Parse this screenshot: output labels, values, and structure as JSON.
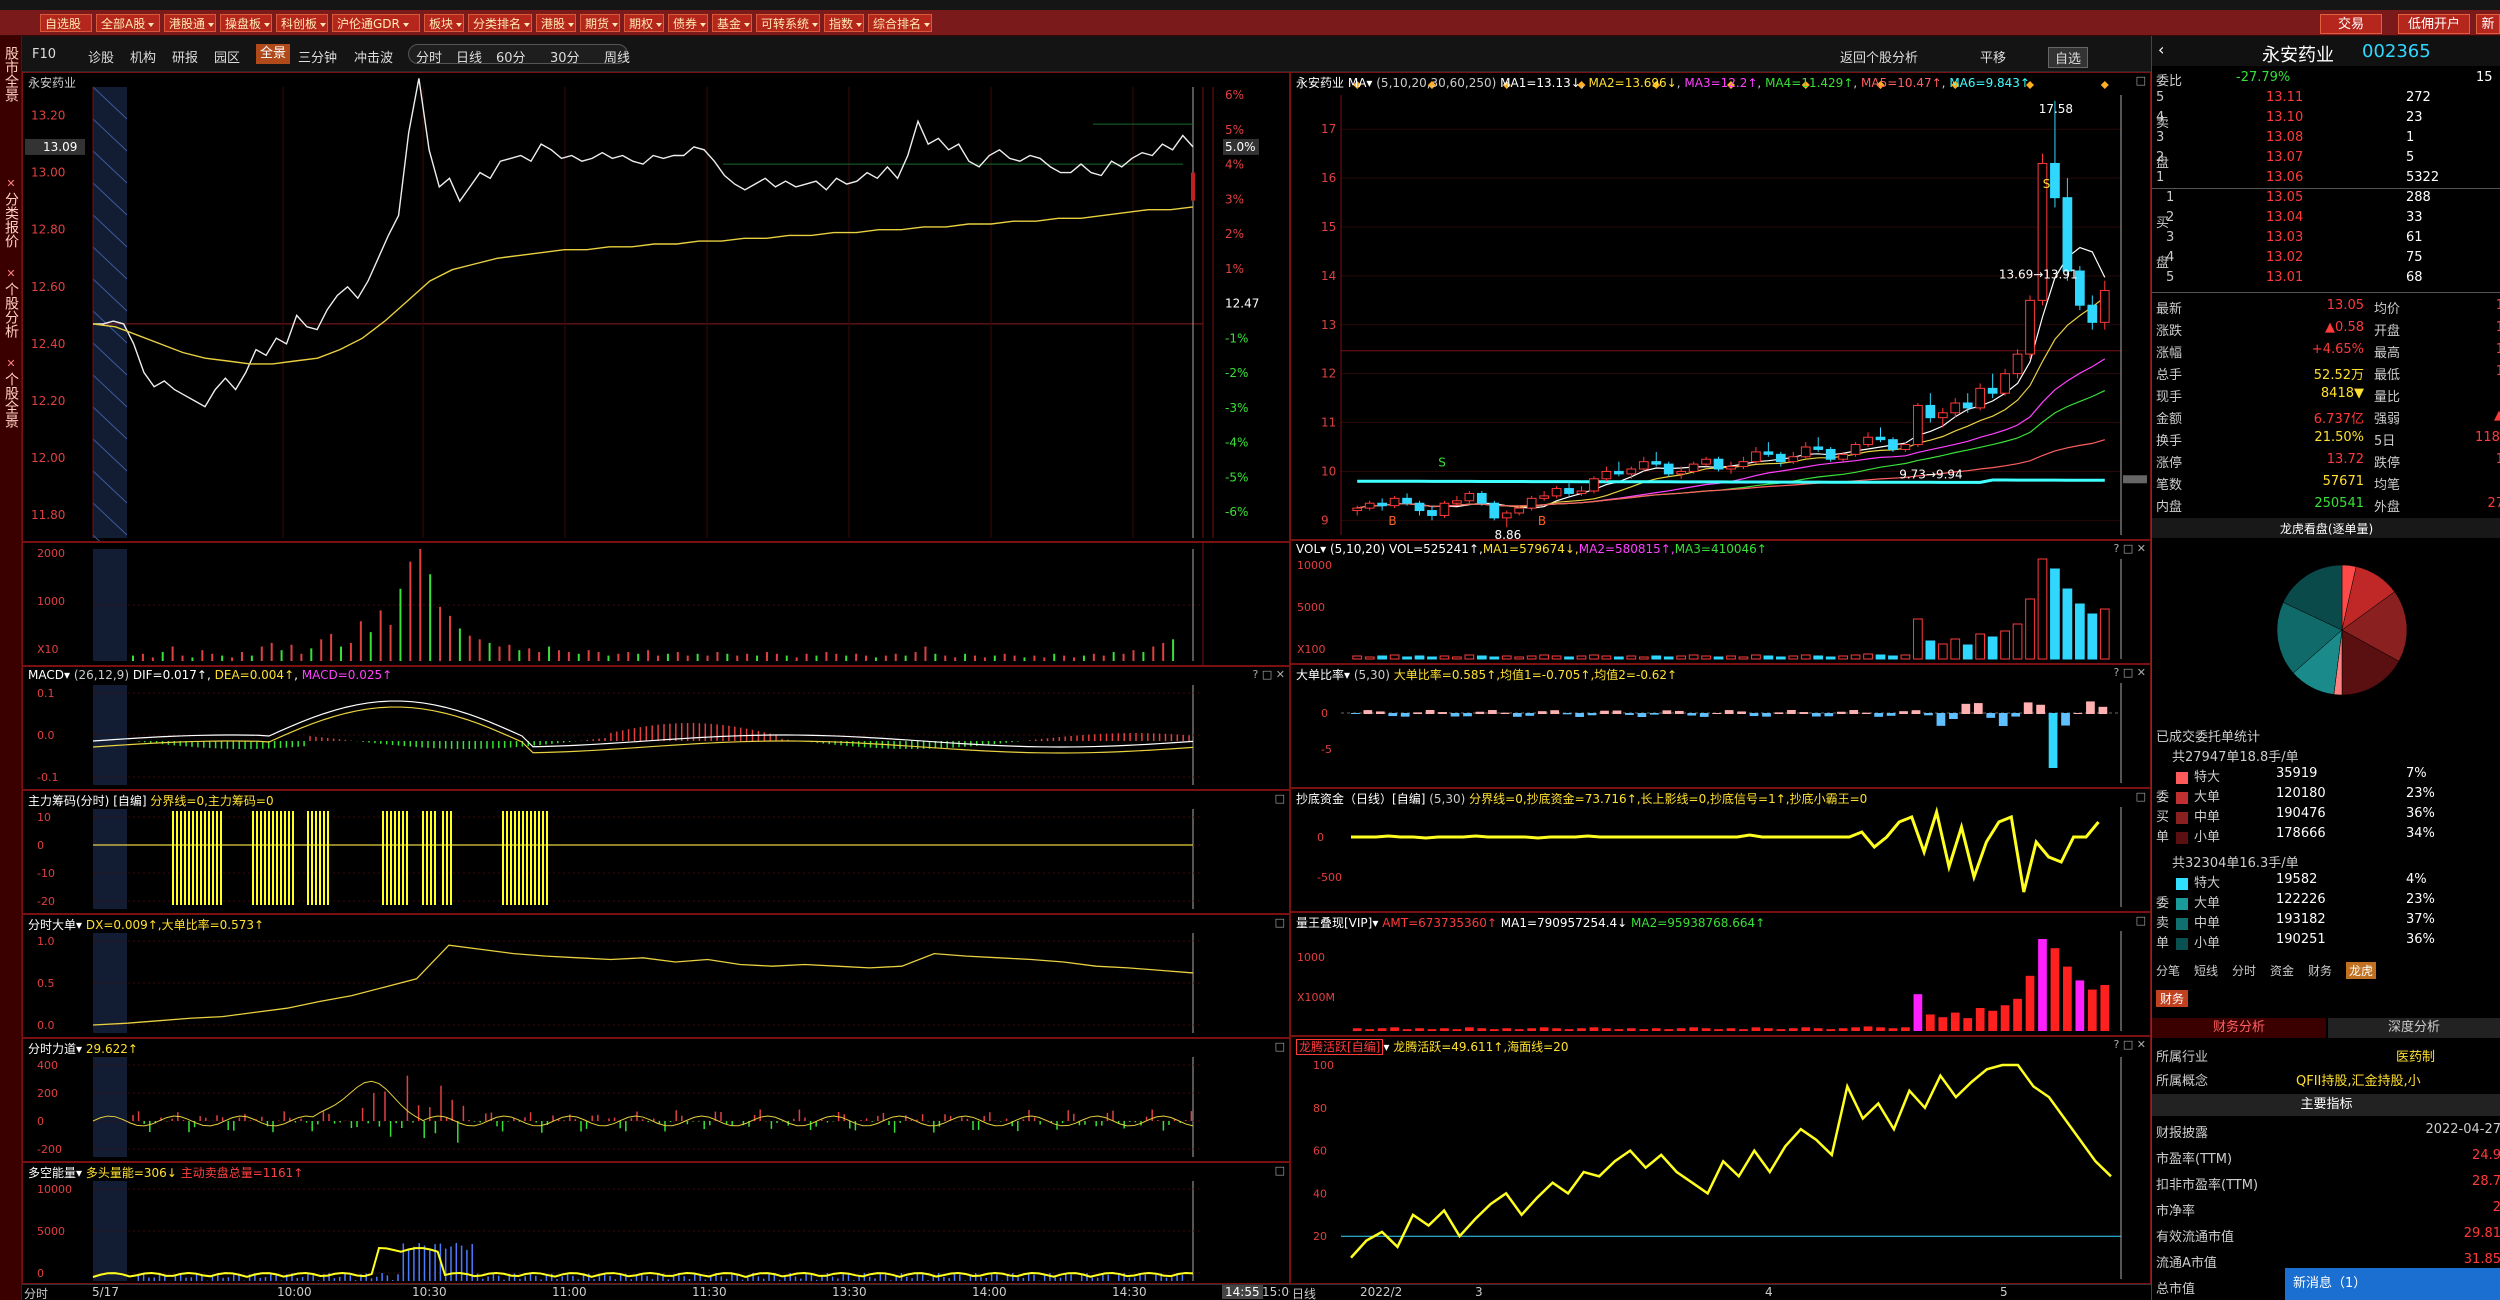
{
  "toolbar": {
    "buttons": [
      "自选股",
      "全部A股",
      "港股通",
      "操盘板",
      "科创板",
      "沪伦通GDR",
      "板块",
      "分类排名",
      "港股",
      "期货",
      "期权",
      "债券",
      "基金",
      "可转系统",
      "指数",
      "综合排名"
    ],
    "trade_btn": "交易",
    "open_account_btn": "低佣开户",
    "news_btn": "新股"
  },
  "leftnav": {
    "items": [
      "股市全景",
      "分类报价",
      "个股分析",
      "个股全景"
    ]
  },
  "periodbar": {
    "items": [
      "F10",
      "诊股",
      "机构",
      "研报",
      "园区",
      "全景",
      "三分钟",
      "冲击波"
    ],
    "selected": "全景",
    "periods": [
      "分时",
      "日线",
      "60分",
      "30分",
      "周线"
    ],
    "right_items": [
      "返回个股分析",
      "平移",
      "自选"
    ]
  },
  "intraday": {
    "stock_name": "永安药业",
    "current_price_label": "13.09",
    "price_ticks": [
      "13.20",
      "13.00",
      "12.80",
      "12.60",
      "12.40",
      "12.20",
      "12.00",
      "11.80"
    ],
    "pct_ticks": [
      "6%",
      "5%",
      "4%",
      "3%",
      "2%",
      "1%",
      "12.47",
      "-1%",
      "-2%",
      "-3%",
      "-4%",
      "-5%",
      "-6%"
    ],
    "current_pct_label": "5.0%",
    "vol_ticks": [
      "2000",
      "1000",
      "X10"
    ],
    "time_ticks": [
      "5/17",
      "10:00",
      "10:30",
      "11:00",
      "11:30",
      "13:30",
      "14:00",
      "14:30",
      "14:55",
      "15:00"
    ],
    "bottom_left": "分时",
    "price_series": [
      12.47,
      12.47,
      12.48,
      12.47,
      12.4,
      12.3,
      12.25,
      12.27,
      12.24,
      12.22,
      12.2,
      12.18,
      12.24,
      12.28,
      12.24,
      12.3,
      12.38,
      12.36,
      12.42,
      12.4,
      12.5,
      12.46,
      12.45,
      12.52,
      12.57,
      12.6,
      12.56,
      12.62,
      12.7,
      12.78,
      12.85,
      13.14,
      13.33,
      13.08,
      12.95,
      12.98,
      12.9,
      12.95,
      13.0,
      12.98,
      13.04,
      13.05,
      13.06,
      13.04,
      13.1,
      13.08,
      13.05,
      13.06,
      13.04,
      13.05,
      13.07,
      13.05,
      13.06,
      13.04,
      13.03,
      13.06,
      13.05,
      13.06,
      13.06,
      13.09,
      13.08,
      13.04,
      12.99,
      12.96,
      12.94,
      12.96,
      12.98,
      12.95,
      12.97,
      12.95,
      12.96,
      12.97,
      12.94,
      12.98,
      12.96,
      12.97,
      13.0,
      12.98,
      13.02,
      12.98,
      13.06,
      13.18,
      13.1,
      13.12,
      13.08,
      13.1,
      13.04,
      13.02,
      13.06,
      13.08,
      13.05,
      13.04,
      13.06,
      13.05,
      13.02,
      13.0,
      13.0,
      13.03,
      13.0,
      12.99,
      13.04,
      13.02,
      13.05,
      13.07,
      13.06,
      13.1,
      13.08,
      13.13,
      13.09
    ],
    "avg_series": [
      12.47,
      12.46,
      12.43,
      12.4,
      12.37,
      12.35,
      12.34,
      12.33,
      12.33,
      12.34,
      12.35,
      12.38,
      12.42,
      12.48,
      12.55,
      12.62,
      12.66,
      12.68,
      12.7,
      12.71,
      12.72,
      12.73,
      12.73,
      12.74,
      12.74,
      12.75,
      12.75,
      12.76,
      12.76,
      12.77,
      12.77,
      12.78,
      12.78,
      12.79,
      12.79,
      12.8,
      12.8,
      12.81,
      12.81,
      12.82,
      12.82,
      12.83,
      12.83,
      12.84,
      12.84,
      12.85,
      12.86,
      12.87,
      12.87,
      12.88
    ],
    "volume_series": [
      3,
      4,
      2,
      5,
      8,
      3,
      2,
      6,
      4,
      3,
      2,
      5,
      3,
      8,
      10,
      6,
      9,
      4,
      7,
      12,
      15,
      8,
      10,
      22,
      16,
      28,
      20,
      40,
      55,
      62,
      48,
      30,
      25,
      18,
      14,
      12,
      10,
      8,
      9,
      6,
      7,
      5,
      8,
      6,
      5,
      4,
      6,
      5,
      3,
      4,
      5,
      4,
      6,
      3,
      4,
      5,
      3,
      4,
      3,
      5,
      4,
      3,
      4,
      3,
      5,
      4,
      3,
      2,
      4,
      3,
      5,
      4,
      3,
      4,
      3,
      2,
      3,
      4,
      3,
      5,
      8,
      4,
      3,
      2,
      4,
      3,
      2,
      3,
      4,
      3,
      2,
      3,
      2,
      4,
      3,
      2,
      3,
      4,
      3,
      5,
      4,
      6,
      5,
      8,
      10,
      12
    ]
  },
  "macd": {
    "title": "MACD",
    "params": "(26,12,9)",
    "dif": "DIF=0.017↑",
    "dea": "DEA=0.004↑",
    "macd": "MACD=0.025↑",
    "ticks": [
      "0.1",
      "0.0",
      "-0.1"
    ]
  },
  "zljm": {
    "title": "主力筹码(分时)",
    "tag": "[自编]",
    "text": "分界线=0,主力筹码=0",
    "ticks": [
      "10",
      "0",
      "-10",
      "-20"
    ]
  },
  "fsdd": {
    "title": "分时大单",
    "text": "DX=0.009↑,大单比率=0.573↑",
    "ticks": [
      "1.0",
      "0.5",
      "0.0"
    ]
  },
  "fsld": {
    "title": "分时力道",
    "value": "29.622↑",
    "ticks": [
      "400",
      "200",
      "0",
      "-200"
    ]
  },
  "dkn": {
    "title": "多空能量",
    "text": "多头量能=306↓",
    "text2": "主动卖盘总量=1161↑",
    "ticks": [
      "10000",
      "5000",
      "0"
    ]
  },
  "kline": {
    "stock_name": "永安药业",
    "ma_label": "MA",
    "params": "(5,10,20,30,60,250)",
    "ma1": "MA1=13.13↓",
    "ma2": "MA2=13.696↓",
    "ma3": "MA3=12.2↑",
    "ma4": "MA4=11.429↑",
    "ma5": "MA5=10.47↑",
    "ma6": "MA6=9.843↑",
    "price_ticks": [
      "17",
      "16",
      "15",
      "14",
      "13",
      "12",
      "11",
      "10",
      "9"
    ],
    "annot_high": "17.58",
    "annot_cross": "13.69→13.91",
    "annot_low1": "9.73→9.94",
    "annot_low2": "8.86",
    "date_ticks": [
      "2022/2",
      "3",
      "4",
      "5"
    ],
    "bottom_left": "日线",
    "candles": [
      [
        9.2,
        9.3,
        9.1,
        9.25
      ],
      [
        9.25,
        9.4,
        9.2,
        9.35
      ],
      [
        9.35,
        9.45,
        9.2,
        9.3
      ],
      [
        9.3,
        9.5,
        9.25,
        9.45
      ],
      [
        9.45,
        9.55,
        9.3,
        9.35
      ],
      [
        9.35,
        9.4,
        9.1,
        9.2
      ],
      [
        9.2,
        9.3,
        9.0,
        9.1
      ],
      [
        9.1,
        9.4,
        9.05,
        9.35
      ],
      [
        9.35,
        9.5,
        9.3,
        9.4
      ],
      [
        9.4,
        9.6,
        9.35,
        9.55
      ],
      [
        9.55,
        9.6,
        9.3,
        9.35
      ],
      [
        9.35,
        9.4,
        9.0,
        9.05
      ],
      [
        9.05,
        9.2,
        8.86,
        9.15
      ],
      [
        9.15,
        9.3,
        9.1,
        9.25
      ],
      [
        9.25,
        9.5,
        9.2,
        9.45
      ],
      [
        9.45,
        9.6,
        9.4,
        9.5
      ],
      [
        9.5,
        9.7,
        9.45,
        9.65
      ],
      [
        9.65,
        9.8,
        9.5,
        9.55
      ],
      [
        9.55,
        9.7,
        9.5,
        9.6
      ],
      [
        9.6,
        9.9,
        9.55,
        9.85
      ],
      [
        9.85,
        10.1,
        9.8,
        10.0
      ],
      [
        10.0,
        10.2,
        9.9,
        9.95
      ],
      [
        9.95,
        10.1,
        9.85,
        10.05
      ],
      [
        10.05,
        10.3,
        10.0,
        10.2
      ],
      [
        10.2,
        10.4,
        10.1,
        10.15
      ],
      [
        10.15,
        10.2,
        9.9,
        9.95
      ],
      [
        9.95,
        10.1,
        9.85,
        10.0
      ],
      [
        10.0,
        10.2,
        9.95,
        10.15
      ],
      [
        10.15,
        10.3,
        10.1,
        10.25
      ],
      [
        10.25,
        10.3,
        10.0,
        10.05
      ],
      [
        10.05,
        10.2,
        9.95,
        10.1
      ],
      [
        10.1,
        10.3,
        10.05,
        10.2
      ],
      [
        10.2,
        10.5,
        10.15,
        10.4
      ],
      [
        10.4,
        10.6,
        10.3,
        10.35
      ],
      [
        10.35,
        10.4,
        10.1,
        10.2
      ],
      [
        10.2,
        10.4,
        10.15,
        10.3
      ],
      [
        10.3,
        10.6,
        10.25,
        10.5
      ],
      [
        10.5,
        10.7,
        10.4,
        10.45
      ],
      [
        10.45,
        10.5,
        10.2,
        10.25
      ],
      [
        10.25,
        10.4,
        10.2,
        10.35
      ],
      [
        10.35,
        10.6,
        10.3,
        10.55
      ],
      [
        10.55,
        10.8,
        10.5,
        10.7
      ],
      [
        10.7,
        10.9,
        10.6,
        10.65
      ],
      [
        10.65,
        10.7,
        10.4,
        10.45
      ],
      [
        10.45,
        10.6,
        10.4,
        10.55
      ],
      [
        10.55,
        11.4,
        10.5,
        11.35
      ],
      [
        11.35,
        11.6,
        11.0,
        11.1
      ],
      [
        11.1,
        11.3,
        10.9,
        11.2
      ],
      [
        11.2,
        11.5,
        11.1,
        11.4
      ],
      [
        11.4,
        11.6,
        11.2,
        11.3
      ],
      [
        11.3,
        11.8,
        11.25,
        11.7
      ],
      [
        11.7,
        12.0,
        11.5,
        11.6
      ],
      [
        11.6,
        12.1,
        11.55,
        12.0
      ],
      [
        12.0,
        12.5,
        11.9,
        12.4
      ],
      [
        12.4,
        13.6,
        12.3,
        13.5
      ],
      [
        13.5,
        16.5,
        13.4,
        16.3
      ],
      [
        16.3,
        17.58,
        15.4,
        15.6
      ],
      [
        15.6,
        16.0,
        13.9,
        14.1
      ],
      [
        14.1,
        14.2,
        13.3,
        13.4
      ],
      [
        13.4,
        13.6,
        12.9,
        13.05
      ],
      [
        13.05,
        13.9,
        12.9,
        13.7
      ]
    ],
    "vol_ticks": [
      "10000",
      "5000",
      "X100"
    ],
    "vol_series": [
      3,
      2,
      3,
      4,
      2,
      3,
      2,
      3,
      2,
      4,
      3,
      2,
      3,
      2,
      3,
      4,
      3,
      2,
      3,
      4,
      3,
      2,
      3,
      2,
      3,
      2,
      3,
      4,
      3,
      2,
      3,
      2,
      4,
      3,
      2,
      3,
      4,
      3,
      2,
      3,
      4,
      5,
      4,
      3,
      4,
      40,
      18,
      15,
      20,
      14,
      25,
      22,
      28,
      35,
      60,
      100,
      90,
      70,
      55,
      45,
      50
    ],
    "ddbl": {
      "title": "大单比率",
      "params": "(5,30)",
      "text": "大单比率=0.585↑,均值1=-0.705↑,均值2=-0.62↑",
      "ticks": [
        "0",
        "-5"
      ]
    },
    "cdzj": {
      "title": "抄底资金（日线）",
      "tag": "[自编]",
      "params": "(5,30)",
      "text": "分界线=0,抄底资金=73.716↑,长上影线=0,抄底信号=1↑,抄底小霸王=0",
      "ticks": [
        "0",
        "-500"
      ]
    },
    "lwdx": {
      "title": "量王叠现[VIP]",
      "text": "AMT=673735360↑",
      "text2": "MA1=790957254.4↓",
      "text3": "MA2=95938768.664↑",
      "ticks": [
        "1000",
        "X100M"
      ]
    },
    "ltjy": {
      "title": "龙腾活跃[自编]",
      "text": "龙腾活跃=49.611↑,海面线=20",
      "ticks": [
        "100",
        "80",
        "60",
        "40",
        "20"
      ],
      "series": [
        10,
        18,
        22,
        15,
        30,
        25,
        32,
        20,
        28,
        35,
        40,
        30,
        38,
        45,
        40,
        50,
        48,
        55,
        60,
        52,
        58,
        50,
        45,
        40,
        55,
        48,
        60,
        50,
        62,
        70,
        65,
        58,
        90,
        75,
        82,
        70,
        88,
        80,
        95,
        85,
        92,
        98,
        100,
        100,
        90,
        85,
        75,
        65,
        55,
        48
      ]
    }
  },
  "rightpanel": {
    "stock_name": "永安药业",
    "stock_code": "002365",
    "weibi_label": "委比",
    "weibi_value": "-27.79%",
    "weibi_right": "15",
    "asks": [
      [
        "5",
        "13.11",
        "272"
      ],
      [
        "4",
        "13.10",
        "23"
      ],
      [
        "3",
        "13.08",
        "1"
      ],
      [
        "2",
        "13.07",
        "5"
      ],
      [
        "1",
        "13.06",
        "5322"
      ]
    ],
    "ask_side_label": [
      "卖",
      "盘"
    ],
    "bids": [
      [
        "1",
        "13.05",
        "288"
      ],
      [
        "2",
        "13.04",
        "33"
      ],
      [
        "3",
        "13.03",
        "61"
      ],
      [
        "4",
        "13.02",
        "75"
      ],
      [
        "5",
        "13.01",
        "68"
      ]
    ],
    "bid_side_label": [
      "买",
      "盘"
    ],
    "quote": [
      [
        "最新",
        "13.05",
        "均价",
        "1"
      ],
      [
        "涨跌",
        "▲0.58",
        "开盘",
        "1"
      ],
      [
        "涨幅",
        "+4.65%",
        "最高",
        "1"
      ],
      [
        "总手",
        "52.52万",
        "最低",
        "1"
      ],
      [
        "现手",
        "8418▼",
        "量比",
        ""
      ],
      [
        "金额",
        "6.737亿",
        "强弱",
        "▲"
      ],
      [
        "换手",
        "21.50%",
        "5日",
        "118."
      ],
      [
        "涨停",
        "13.72",
        "跌停",
        "1"
      ],
      [
        "笔数",
        "57671",
        "均笔",
        ""
      ],
      [
        "内盘",
        "250541",
        "外盘",
        "27"
      ]
    ],
    "pie_title": "龙虎看盘(逐单量)",
    "entrust_title": "已成交委托单统计",
    "buy_total": "共27947单18.8手/单",
    "buy_rows": [
      [
        "特大",
        "35919",
        "7%"
      ],
      [
        "大单",
        "120180",
        "23%"
      ],
      [
        "中单",
        "190476",
        "36%"
      ],
      [
        "小单",
        "178666",
        "34%"
      ]
    ],
    "buy_side": [
      "委",
      "买",
      "单"
    ],
    "sell_total": "共32304单16.3手/单",
    "sell_rows": [
      [
        "特大",
        "19582",
        "4%"
      ],
      [
        "大单",
        "122226",
        "23%"
      ],
      [
        "中单",
        "193182",
        "37%"
      ],
      [
        "小单",
        "190251",
        "36%"
      ]
    ],
    "sell_side": [
      "委",
      "卖",
      "单"
    ],
    "tabs": [
      "分笔",
      "短线",
      "分时",
      "资金",
      "财务",
      "龙虎"
    ],
    "tab_selected": "龙虎",
    "fin_tab": "财务",
    "fin_subtabs": [
      "财务分析",
      "深度分析"
    ],
    "industry_label": "所属行业",
    "industry_value": "医药制",
    "concept_label": "所属概念",
    "concept_value": "QFII持股,汇金持股,小",
    "main_index": "主要指标",
    "fin_rows": [
      [
        "财报披露",
        "2022-04-27"
      ],
      [
        "市盈率(TTM)",
        "24.9"
      ],
      [
        "扣非市盈率(TTM)",
        "28.7"
      ],
      [
        "市净率",
        "2"
      ],
      [
        "有效流通市值",
        "29.81"
      ],
      [
        "流通A市值",
        "31.85"
      ],
      [
        "总市值",
        ""
      ]
    ],
    "news": "新消息（1）"
  }
}
